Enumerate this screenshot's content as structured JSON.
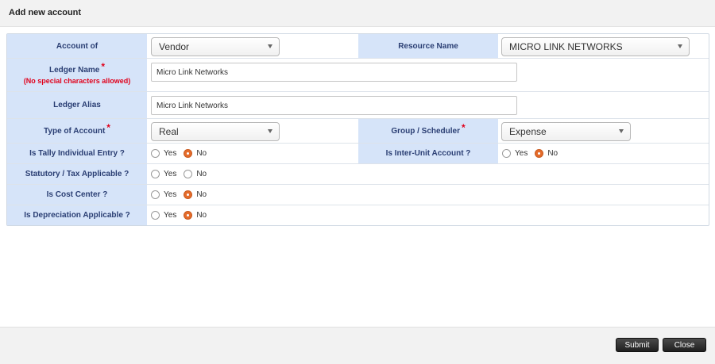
{
  "dialog": {
    "title": "Add new account"
  },
  "fields": {
    "account_of": {
      "label": "Account of",
      "value": "Vendor"
    },
    "resource_name": {
      "label": "Resource Name",
      "value": "MICRO LINK NETWORKS"
    },
    "ledger_name": {
      "label": "Ledger Name",
      "required_mark": "*",
      "note": "(No special characters allowed)",
      "value": "Micro Link Networks"
    },
    "ledger_alias": {
      "label": "Ledger Alias",
      "value": "Micro Link Networks"
    },
    "type_of_account": {
      "label": "Type of Account",
      "required_mark": "*",
      "value": "Real"
    },
    "group_scheduler": {
      "label": "Group / Scheduler",
      "required_mark": "*",
      "value": "Expense"
    },
    "tally_individual": {
      "label": "Is Tally Individual Entry ?",
      "yes": "Yes",
      "no": "No",
      "selected": "No"
    },
    "inter_unit": {
      "label": "Is Inter-Unit Account ?",
      "yes": "Yes",
      "no": "No",
      "selected": "No"
    },
    "statutory_tax": {
      "label": "Statutory / Tax Applicable ?",
      "yes": "Yes",
      "no": "No",
      "selected": ""
    },
    "cost_center": {
      "label": "Is Cost Center ?",
      "yes": "Yes",
      "no": "No",
      "selected": "No"
    },
    "depreciation": {
      "label": "Is Depreciation Applicable ?",
      "yes": "Yes",
      "no": "No",
      "selected": "No"
    }
  },
  "footer": {
    "submit_label": "Submit",
    "close_label": "Close"
  }
}
